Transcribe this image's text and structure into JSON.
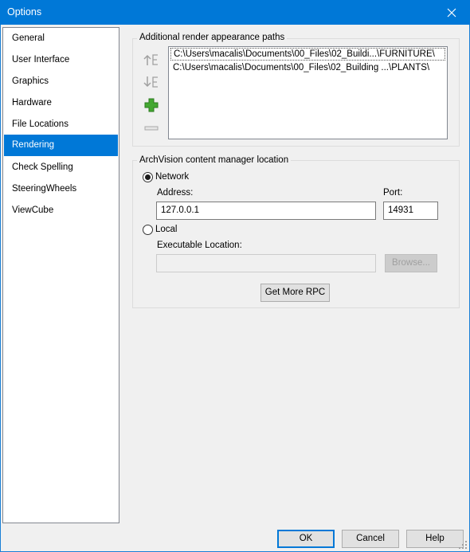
{
  "window": {
    "title": "Options",
    "close_icon": "close-icon"
  },
  "nav": {
    "items": [
      {
        "label": "General"
      },
      {
        "label": "User Interface"
      },
      {
        "label": "Graphics"
      },
      {
        "label": "Hardware"
      },
      {
        "label": "File Locations"
      },
      {
        "label": "Rendering",
        "selected": true
      },
      {
        "label": "Check Spelling"
      },
      {
        "label": "SteeringWheels"
      },
      {
        "label": "ViewCube"
      }
    ]
  },
  "paths_group": {
    "title": "Additional render appearance paths",
    "paths": [
      "C:\\Users\\macalis\\Documents\\00_Files\\02_Buildi...\\FURNITURE\\",
      "C:\\Users\\macalis\\Documents\\00_Files\\02_Building ...\\PLANTS\\"
    ],
    "icons": [
      "move-up-icon",
      "move-down-icon",
      "add-path-icon",
      "remove-path-icon"
    ]
  },
  "archvision": {
    "title": "ArchVision content manager location",
    "network": {
      "label": "Network",
      "selected": true,
      "address_label": "Address:",
      "address_value": "127.0.0.1",
      "port_label": "Port:",
      "port_value": "14931"
    },
    "local": {
      "label": "Local",
      "selected": false,
      "exec_label": "Executable Location:",
      "exec_value": "",
      "browse_label": "Browse..."
    },
    "get_more_label": "Get More RPC"
  },
  "footer": {
    "ok_label": "OK",
    "cancel_label": "Cancel",
    "help_label": "Help"
  },
  "colors": {
    "accent": "#0078d7",
    "add_icon": "#3a9c2e"
  }
}
